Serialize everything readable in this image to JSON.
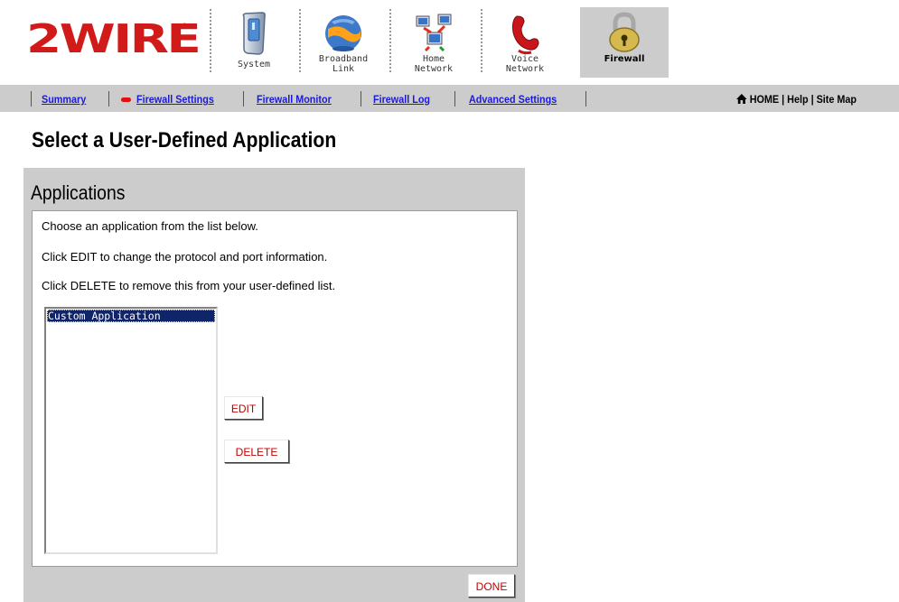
{
  "brand": {
    "logo_text": "2WIRE",
    "registered_mark": "®"
  },
  "colors": {
    "brand_red": "#d11b1b",
    "link_blue": "#1a1adb",
    "nav_gray": "#cccccc",
    "button_text": "#c00000",
    "selection_bg": "#10246a"
  },
  "main_tabs": [
    {
      "label": "System",
      "icon": "system-phone-icon"
    },
    {
      "label": "Broadband\nLink",
      "icon": "broadband-globe-icon"
    },
    {
      "label": "Home\nNetwork",
      "icon": "home-network-computers-icon"
    },
    {
      "label": "Voice\nNetwork",
      "icon": "voice-phone-icon"
    },
    {
      "label": "Firewall",
      "icon": "padlock-icon",
      "active": true
    }
  ],
  "sub_nav": {
    "items": [
      "Summary",
      "Firewall Settings",
      "Firewall Monitor",
      "Firewall Log",
      "Advanced Settings"
    ],
    "active": "Firewall Settings",
    "home": "HOME",
    "help": "Help",
    "site_map": "Site Map",
    "divider": "|"
  },
  "page": {
    "title": "Select a User-Defined Application",
    "panel_title": "Applications",
    "instructions": [
      "Choose an application from the list below.",
      "Click EDIT to change the protocol and port information.",
      "Click DELETE to remove this from your user-defined list."
    ],
    "applications": [
      "Custom Application"
    ],
    "selected_application": "Custom Application",
    "edit_label": "EDIT",
    "delete_label": "DELETE",
    "done_label": "DONE"
  }
}
